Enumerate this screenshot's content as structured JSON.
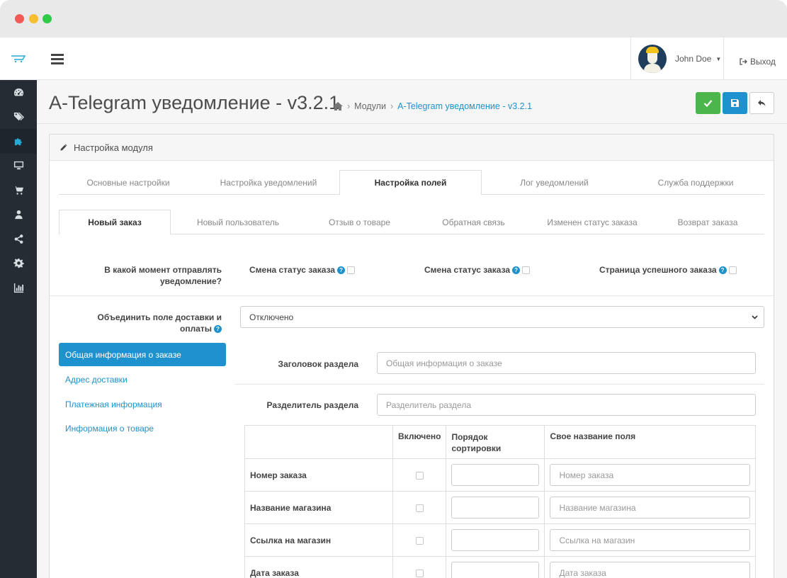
{
  "colors": {
    "sidebar": "#252c34",
    "accent": "#1e91cf",
    "success": "#4cb64c",
    "primary": "#1e91cf"
  },
  "header": {
    "user_name": "John Doe",
    "logout": "Выход"
  },
  "sidebar_icons": [
    "dashboard-icon",
    "tags-icon",
    "puzzle-icon",
    "desktop-icon",
    "cart-icon",
    "user-icon",
    "share-icon",
    "cog-icon",
    "chart-icon"
  ],
  "page": {
    "title": "A-Telegram уведомление - v3.2.1",
    "breadcrumb": [
      "Модули",
      "A-Telegram уведомление - v3.2.1"
    ]
  },
  "panel": {
    "heading": "Настройка модуля",
    "main_tabs": [
      "Основные настройки",
      "Настройка уведомлений",
      "Настройка полей",
      "Лог уведомлений",
      "Служба поддержки"
    ],
    "sub_tabs": [
      "Новый заказ",
      "Новый пользователь",
      "Отзыв о товаре",
      "Обратная связь",
      "Изменен статус заказа",
      "Возврат заказа"
    ]
  },
  "form": {
    "when_label": "В какой момент отправлять уведомление?",
    "option1": "Смена статус заказа",
    "option2": "Смена статус заказа",
    "option3": "Страница успешного заказа",
    "merge_label": "Объединить поле доставки и оплаты",
    "merge_value": "Отключено",
    "section_title_label": "Заголовок раздела",
    "section_title_placeholder": "Общая информация о заказе",
    "section_sep_label": "Разделитель раздела",
    "section_sep_placeholder": "Разделитель раздела"
  },
  "sections": [
    "Общая информация о заказе",
    "Адрес доставки",
    "Платежная информация",
    "Информация о товаре"
  ],
  "table": {
    "headers": [
      "",
      "Включено",
      "Порядок сортировки",
      "Свое название поля"
    ],
    "rows": [
      {
        "name": "Номер заказа",
        "placeholder": "Номер заказа"
      },
      {
        "name": "Название магазина",
        "placeholder": "Название магазина"
      },
      {
        "name": "Ссылка на магазин",
        "placeholder": "Ссылка на магазин"
      },
      {
        "name": "Дата заказа",
        "placeholder": "Дата заказа"
      }
    ]
  }
}
